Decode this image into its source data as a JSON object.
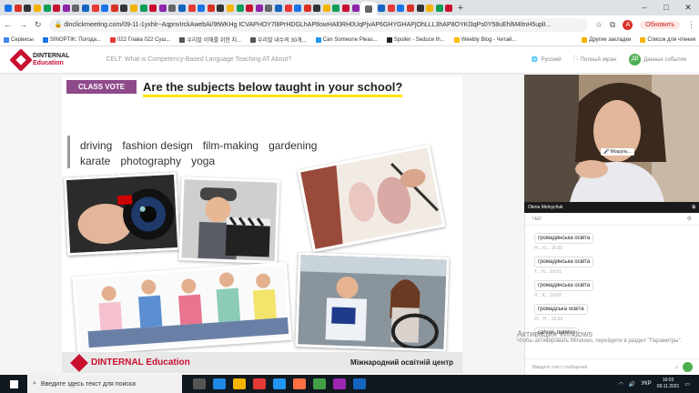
{
  "browser": {
    "url": "dinclickmeeting.com/09-11-1yxhlr~AqpnvIrckAwebAi/9tWKHg ICVAPHOY7l8PrHDGLhAP8owHAl0RH0UqPjvAP6GHYGHAPjOhLLL3hAP8OYKl3qPs0Y58uEhlM4ltnH5uplI...",
    "update_label": "Обновить",
    "avatar_letter": "А",
    "bookmarks": [
      "Сервисы",
      "SINOPTIK: Погода...",
      "022 Глава 022 Суш...",
      "우리말 이해를 위한 지...",
      "우리말 내수의 30개...",
      "Can Someone Pleas...",
      "Spoiler - Seduce th...",
      "Weebly Blog - Читай..."
    ],
    "bookmarks_right": [
      "Другие закладки",
      "Список для чтения"
    ]
  },
  "app": {
    "brand_line1": "DINTERNAL",
    "brand_line2": "Education",
    "event_title": "CELT: What is Competency-Based Language Teaching AT About?",
    "lang": "Русский",
    "fullscreen": "Полный экран",
    "user_initials": "ДВ",
    "user_label": "Данные события"
  },
  "slide": {
    "badge": "CLASS VOTE",
    "question": "Are the subjects below taught in your school?",
    "subjects_row1": [
      "driving",
      "fashion design",
      "film-making",
      "gardening"
    ],
    "subjects_row2": [
      "karate",
      "photography",
      "yoga"
    ],
    "footer_brand": "DINTERNAL Education",
    "footer_right": "Міжнародний освітній центр"
  },
  "video": {
    "mute_label": "Мошуль...",
    "speaker": "Olena Melnychuk"
  },
  "chat": {
    "title": "Чат",
    "messages": [
      {
        "meta": "",
        "text": "громадянська освіта"
      },
      {
        "meta": "Н... О...   16:01",
        "text": "громадянська освіта"
      },
      {
        "meta": "Т... Н...   16:01",
        "text": "громадянська освіта"
      },
      {
        "meta": "Л... К...   16:02",
        "text": "громадська освіта"
      },
      {
        "meta": "О... Н...   16:03",
        "text": "cahool, training"
      }
    ],
    "input_placeholder": "Введите текст сообщения"
  },
  "watermark": {
    "line1": "Активация Windows",
    "line2": "Чтобы активировать Windows, перейдите в раздел \"Параметры\"."
  },
  "taskbar": {
    "search_placeholder": "Введите здесь текст для поиска",
    "lang": "УКР",
    "time": "16:03",
    "date": "09.11.2021"
  }
}
